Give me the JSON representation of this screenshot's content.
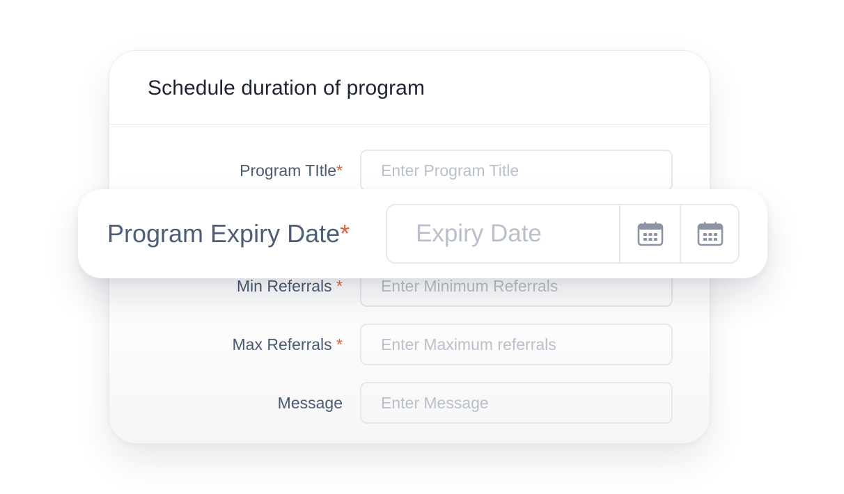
{
  "card": {
    "title": "Schedule duration of program"
  },
  "fields": {
    "program_title": {
      "label": "Program TItle",
      "required_mark": "*",
      "value": "",
      "placeholder": "Enter Program Title"
    },
    "min_referrals": {
      "label": "Min Referrals ",
      "required_mark": "*",
      "value": "",
      "placeholder": "Enter Minimum Referrals"
    },
    "max_referrals": {
      "label": "Max Referrals ",
      "required_mark": "*",
      "value": "",
      "placeholder": "Enter Maximum referrals"
    },
    "message": {
      "label": "Message",
      "value": "",
      "placeholder": "Enter Message"
    }
  },
  "expiry": {
    "label": "Program Expiry Date",
    "required_mark": "*",
    "value": "",
    "placeholder": "Expiry Date",
    "buttons": [
      {
        "icon": "calendar-icon"
      },
      {
        "icon": "calendar-icon"
      }
    ]
  },
  "colors": {
    "label_text": "#4a5a72",
    "required_accent": "#e0623f",
    "placeholder_text": "#b9c0cb",
    "border": "#e6e8ec",
    "title_text": "#1d2433",
    "icon": "#8a94a6"
  }
}
